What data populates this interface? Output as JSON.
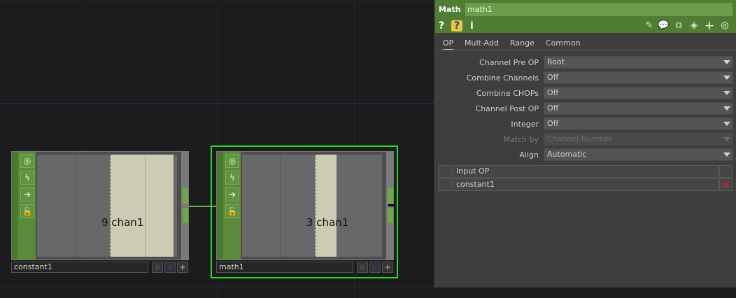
{
  "nodes": {
    "constant1": {
      "name": "constant1",
      "viewer_label": "9 chan1",
      "strip_icons": [
        "viewer-icon",
        "cook-icon",
        "export-icon",
        "lock-icon"
      ]
    },
    "math1": {
      "name": "math1",
      "viewer_label": "3 chan1",
      "strip_icons": [
        "viewer-icon",
        "cook-icon",
        "export-icon",
        "lock-icon"
      ],
      "selected": true
    }
  },
  "panel": {
    "op_type": "Math",
    "op_name": "math1",
    "toolbar": {
      "help": "?",
      "python_help": "?",
      "info": "i"
    },
    "tabs": [
      "OP",
      "Mult-Add",
      "Range",
      "Common"
    ],
    "active_tab": "OP",
    "params": [
      {
        "label": "Channel Pre OP",
        "value": "Root",
        "enabled": true
      },
      {
        "label": "Combine Channels",
        "value": "Off",
        "enabled": true
      },
      {
        "label": "Combine CHOPs",
        "value": "Off",
        "enabled": true
      },
      {
        "label": "Channel Post OP",
        "value": "Off",
        "enabled": true
      },
      {
        "label": "Integer",
        "value": "Off",
        "enabled": true
      },
      {
        "label": "Match by",
        "value": "Channel Number",
        "enabled": false
      },
      {
        "label": "Align",
        "value": "Automatic",
        "enabled": true
      }
    ],
    "input_table": {
      "header": "Input OP",
      "rows": [
        "constant1"
      ],
      "delete_glyph": "✕"
    }
  },
  "colors": {
    "chop_green": "#5b8a3c",
    "panel_header": "#4f7d31",
    "selection": "#22dd22",
    "wire": "#8fd46a"
  }
}
